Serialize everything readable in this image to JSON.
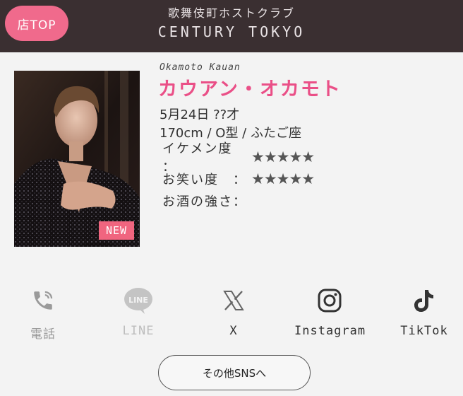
{
  "header": {
    "top_button": "店TOP",
    "subtitle": "歌舞伎町ホストクラブ",
    "title": "CENTURY TOKYO"
  },
  "profile": {
    "romanized_name": "Okamoto Kauan",
    "name": "カウアン・オカモト",
    "birthday_age": "5月24日 ??才",
    "stats": "170cm / O型 / ふたご座",
    "badge": "NEW",
    "ratings": [
      {
        "label": "イケメン度 ：",
        "stars": "★★★★★",
        "value": 5
      },
      {
        "label": "お笑い度　：",
        "stars": "★★★★★",
        "value": 5
      },
      {
        "label": "お酒の強さ：",
        "stars": "",
        "value": 0
      }
    ]
  },
  "sns": {
    "items": [
      {
        "label": "電話",
        "icon": "phone-icon"
      },
      {
        "label": "LINE",
        "icon": "line-icon"
      },
      {
        "label": "X",
        "icon": "x-icon"
      },
      {
        "label": "Instagram",
        "icon": "instagram-icon"
      },
      {
        "label": "TikTok",
        "icon": "tiktok-icon"
      }
    ],
    "more_button": "その他SNSへ"
  },
  "colors": {
    "header_bg": "#3a2f31",
    "accent_pink": "#f06a8c",
    "name_pink": "#ea4f87",
    "badge_pink": "#f0657f",
    "page_bg": "#f3f3f3"
  }
}
